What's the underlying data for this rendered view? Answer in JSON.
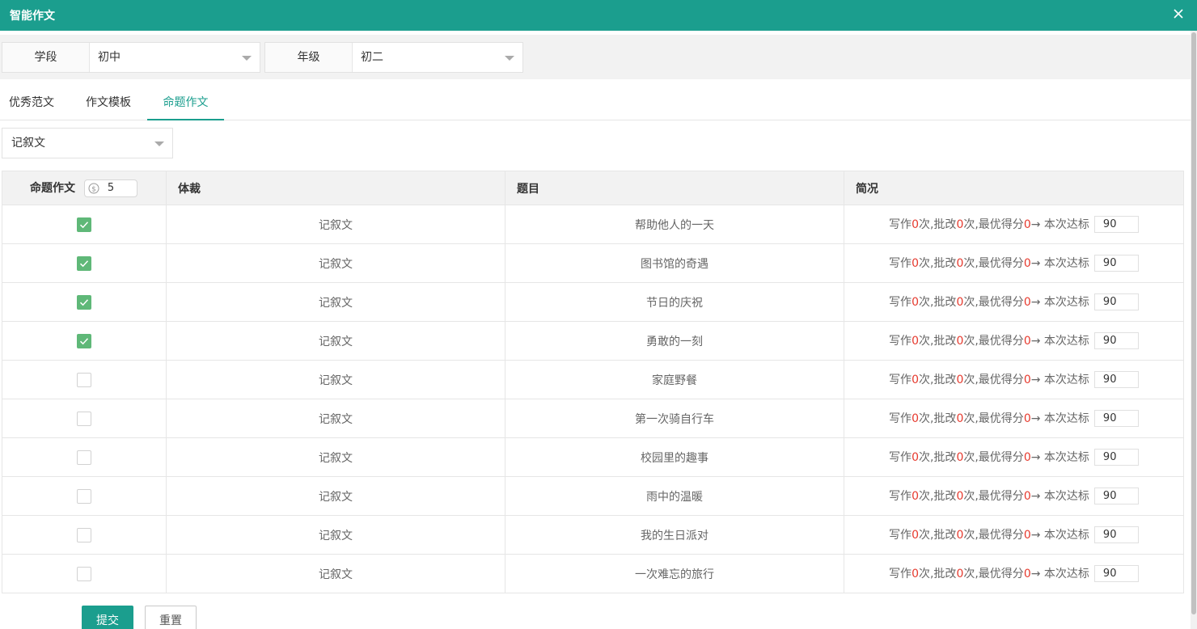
{
  "window": {
    "title": "智能作文"
  },
  "filters": {
    "stage_label": "学段",
    "stage_value": "初中",
    "grade_label": "年级",
    "grade_value": "初二"
  },
  "tabs": [
    {
      "label": "优秀范文",
      "active": false
    },
    {
      "label": "作文模板",
      "active": false
    },
    {
      "label": "命题作文",
      "active": true
    }
  ],
  "genre_select": {
    "value": "记叙文"
  },
  "table": {
    "headers": {
      "select": "命题作文",
      "genre": "体裁",
      "topic": "题目",
      "summary": "简况"
    },
    "coin_count": "5",
    "summary_template": {
      "write_prefix": "写作",
      "count_suffix": "次",
      "review_prefix": ",批改",
      "best_prefix": ",最优得分",
      "target_prefix": "→ 本次达标"
    },
    "rows": [
      {
        "checked": true,
        "genre": "记叙文",
        "topic": "帮助他人的一天",
        "write": "0",
        "review": "0",
        "best": "0",
        "target": "90"
      },
      {
        "checked": true,
        "genre": "记叙文",
        "topic": "图书馆的奇遇",
        "write": "0",
        "review": "0",
        "best": "0",
        "target": "90"
      },
      {
        "checked": true,
        "genre": "记叙文",
        "topic": "节日的庆祝",
        "write": "0",
        "review": "0",
        "best": "0",
        "target": "90"
      },
      {
        "checked": true,
        "genre": "记叙文",
        "topic": "勇敢的一刻",
        "write": "0",
        "review": "0",
        "best": "0",
        "target": "90"
      },
      {
        "checked": false,
        "genre": "记叙文",
        "topic": "家庭野餐",
        "write": "0",
        "review": "0",
        "best": "0",
        "target": "90"
      },
      {
        "checked": false,
        "genre": "记叙文",
        "topic": "第一次骑自行车",
        "write": "0",
        "review": "0",
        "best": "0",
        "target": "90"
      },
      {
        "checked": false,
        "genre": "记叙文",
        "topic": "校园里的趣事",
        "write": "0",
        "review": "0",
        "best": "0",
        "target": "90"
      },
      {
        "checked": false,
        "genre": "记叙文",
        "topic": "雨中的温暖",
        "write": "0",
        "review": "0",
        "best": "0",
        "target": "90"
      },
      {
        "checked": false,
        "genre": "记叙文",
        "topic": "我的生日派对",
        "write": "0",
        "review": "0",
        "best": "0",
        "target": "90"
      },
      {
        "checked": false,
        "genre": "记叙文",
        "topic": "一次难忘的旅行",
        "write": "0",
        "review": "0",
        "best": "0",
        "target": "90"
      }
    ]
  },
  "actions": {
    "submit_label": "提交",
    "reset_label": "重置"
  },
  "colors": {
    "brand": "#1b9e8e",
    "checked": "#5fb878",
    "highlight": "#e63a2e"
  }
}
